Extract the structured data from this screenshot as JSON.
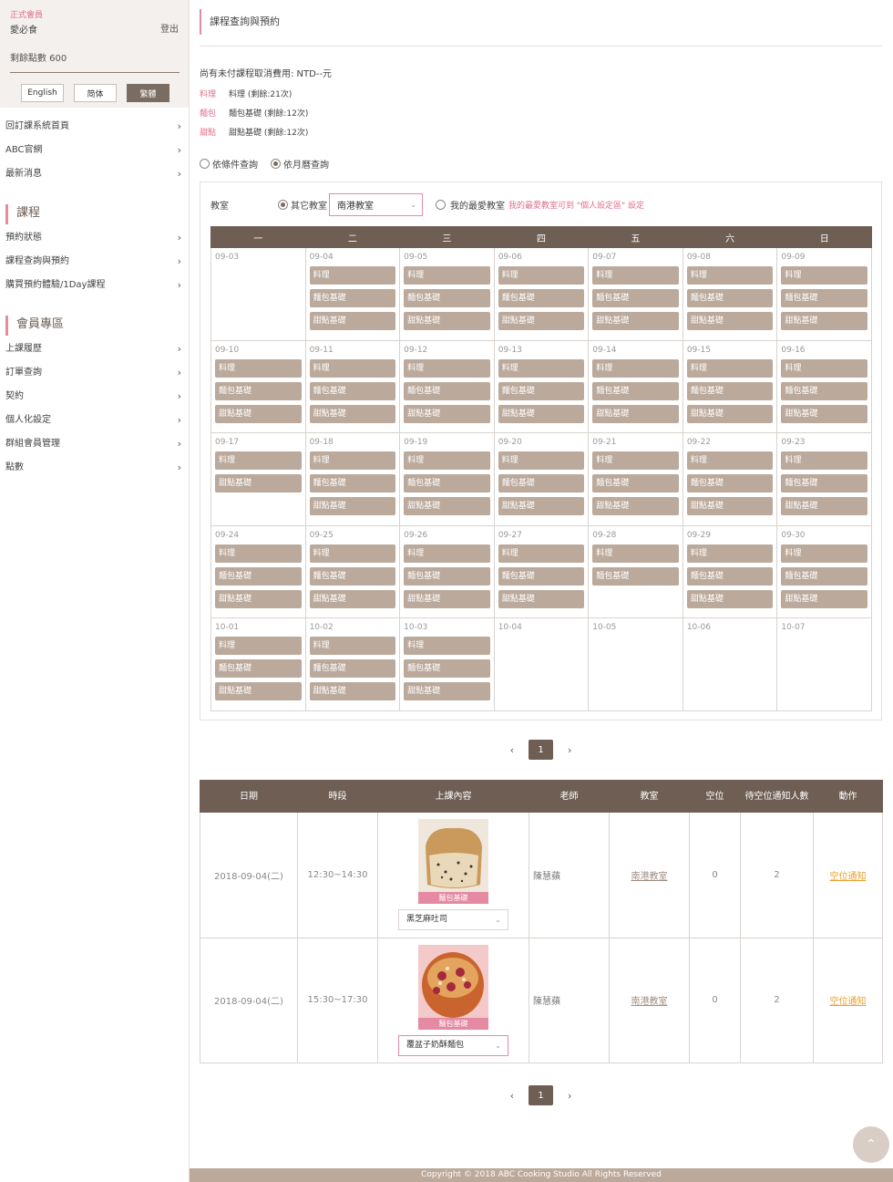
{
  "sidebar": {
    "member_level": "正式會員",
    "member_name": "愛必食",
    "logout": "登出",
    "points": "剩餘點數 600",
    "languages": [
      "English",
      "简体",
      "繁體"
    ],
    "active_language": "繁體",
    "top_links": [
      "回訂課系統首頁",
      "ABC官網",
      "最新消息"
    ],
    "course_heading": "課程",
    "course_links": [
      "預約狀態",
      "課程查詢與預約",
      "購買預約體驗/1Day課程"
    ],
    "member_heading": "會員專區",
    "member_links": [
      "上課履歷",
      "訂單查詢",
      "契約",
      "個人化設定",
      "群組會員管理",
      "點數"
    ]
  },
  "main": {
    "page_title": "課程查詢與預約",
    "unpaid_notice": "尚有未付課程取消費用: NTD--元",
    "credits": [
      {
        "cat": "料理",
        "text": "料理 (剩餘:21次)"
      },
      {
        "cat": "麵包",
        "text": "麵包基礎 (剩餘:12次)"
      },
      {
        "cat": "甜點",
        "text": "甜點基礎 (剩餘:12次)"
      }
    ],
    "query_by_condition": "依條件查詢",
    "query_by_calendar": "依月曆查詢",
    "filter": {
      "label": "教室",
      "other_classroom": "其它教室",
      "selected_classroom": "南港教室",
      "favorite_classroom": "我的最愛教室",
      "favorite_note": "我的最愛教室可到 \"個人設定區\" 設定"
    },
    "weekdays": [
      "一",
      "二",
      "三",
      "四",
      "五",
      "六",
      "日"
    ],
    "weeks": [
      [
        {
          "date": "09-03",
          "classes": []
        },
        {
          "date": "09-04",
          "classes": [
            "料理",
            "麵包基礎",
            "甜點基礎"
          ]
        },
        {
          "date": "09-05",
          "classes": [
            "料理",
            "麵包基礎",
            "甜點基礎"
          ]
        },
        {
          "date": "09-06",
          "classes": [
            "料理",
            "麵包基礎",
            "甜點基礎"
          ]
        },
        {
          "date": "09-07",
          "classes": [
            "料理",
            "麵包基礎",
            "甜點基礎"
          ]
        },
        {
          "date": "09-08",
          "classes": [
            "料理",
            "麵包基礎",
            "甜點基礎"
          ]
        },
        {
          "date": "09-09",
          "classes": [
            "料理",
            "麵包基礎",
            "甜點基礎"
          ]
        }
      ],
      [
        {
          "date": "09-10",
          "classes": [
            "料理",
            "麵包基礎",
            "甜點基礎"
          ]
        },
        {
          "date": "09-11",
          "classes": [
            "料理",
            "麵包基礎",
            "甜點基礎"
          ]
        },
        {
          "date": "09-12",
          "classes": [
            "料理",
            "麵包基礎",
            "甜點基礎"
          ]
        },
        {
          "date": "09-13",
          "classes": [
            "料理",
            "麵包基礎",
            "甜點基礎"
          ]
        },
        {
          "date": "09-14",
          "classes": [
            "料理",
            "麵包基礎",
            "甜點基礎"
          ]
        },
        {
          "date": "09-15",
          "classes": [
            "料理",
            "麵包基礎",
            "甜點基礎"
          ]
        },
        {
          "date": "09-16",
          "classes": [
            "料理",
            "麵包基礎",
            "甜點基礎"
          ]
        }
      ],
      [
        {
          "date": "09-17",
          "classes": [
            "料理",
            "甜點基礎"
          ]
        },
        {
          "date": "09-18",
          "classes": [
            "料理",
            "麵包基礎",
            "甜點基礎"
          ]
        },
        {
          "date": "09-19",
          "classes": [
            "料理",
            "麵包基礎",
            "甜點基礎"
          ]
        },
        {
          "date": "09-20",
          "classes": [
            "料理",
            "麵包基礎",
            "甜點基礎"
          ]
        },
        {
          "date": "09-21",
          "classes": [
            "料理",
            "麵包基礎",
            "甜點基礎"
          ]
        },
        {
          "date": "09-22",
          "classes": [
            "料理",
            "麵包基礎",
            "甜點基礎"
          ]
        },
        {
          "date": "09-23",
          "classes": [
            "料理",
            "麵包基礎",
            "甜點基礎"
          ]
        }
      ],
      [
        {
          "date": "09-24",
          "classes": [
            "料理",
            "麵包基礎",
            "甜點基礎"
          ]
        },
        {
          "date": "09-25",
          "classes": [
            "料理",
            "麵包基礎",
            "甜點基礎"
          ]
        },
        {
          "date": "09-26",
          "classes": [
            "料理",
            "麵包基礎",
            "甜點基礎"
          ]
        },
        {
          "date": "09-27",
          "classes": [
            "料理",
            "麵包基礎",
            "甜點基礎"
          ]
        },
        {
          "date": "09-28",
          "classes": [
            "料理",
            "麵包基礎"
          ]
        },
        {
          "date": "09-29",
          "classes": [
            "料理",
            "麵包基礎",
            "甜點基礎"
          ]
        },
        {
          "date": "09-30",
          "classes": [
            "料理",
            "麵包基礎",
            "甜點基礎"
          ]
        }
      ],
      [
        {
          "date": "10-01",
          "classes": [
            "料理",
            "麵包基礎",
            "甜點基礎"
          ]
        },
        {
          "date": "10-02",
          "classes": [
            "料理",
            "麵包基礎",
            "甜點基礎"
          ]
        },
        {
          "date": "10-03",
          "classes": [
            "料理",
            "麵包基礎",
            "甜點基礎"
          ]
        },
        {
          "date": "10-04",
          "classes": []
        },
        {
          "date": "10-05",
          "classes": []
        },
        {
          "date": "10-06",
          "classes": []
        },
        {
          "date": "10-07",
          "classes": []
        }
      ]
    ],
    "pager": {
      "prev": "‹",
      "current": "1",
      "next": "›"
    },
    "schedule_headers": [
      "日期",
      "時段",
      "上課內容",
      "老師",
      "教室",
      "空位",
      "待空位通知人數",
      "動作"
    ],
    "schedule_rows": [
      {
        "date": "2018-09-04(二)",
        "time": "12:30~14:30",
        "tag": "麵包基礎",
        "recipe": "黑芝麻吐司",
        "teacher": "陳慧蘋",
        "classroom": "南港教室",
        "seats": "0",
        "waiting": "2",
        "action": "空位通知"
      },
      {
        "date": "2018-09-04(二)",
        "time": "15:30~17:30",
        "tag": "麵包基礎",
        "recipe": "覆盆子奶酥麵包",
        "teacher": "陳慧蘋",
        "classroom": "南港教室",
        "seats": "0",
        "waiting": "2",
        "action": "空位通知"
      }
    ]
  },
  "footer": {
    "copyright": "Copyright © 2018 ABC Cooking Studio All Rights Reserved"
  },
  "icons": {
    "to_top": "chevron-up-icon"
  },
  "colors": {
    "accent_pink": "#e58aa3",
    "brown_header": "#6e5e53",
    "class_chip": "#bba99b",
    "notify_link": "#e8a12e"
  }
}
